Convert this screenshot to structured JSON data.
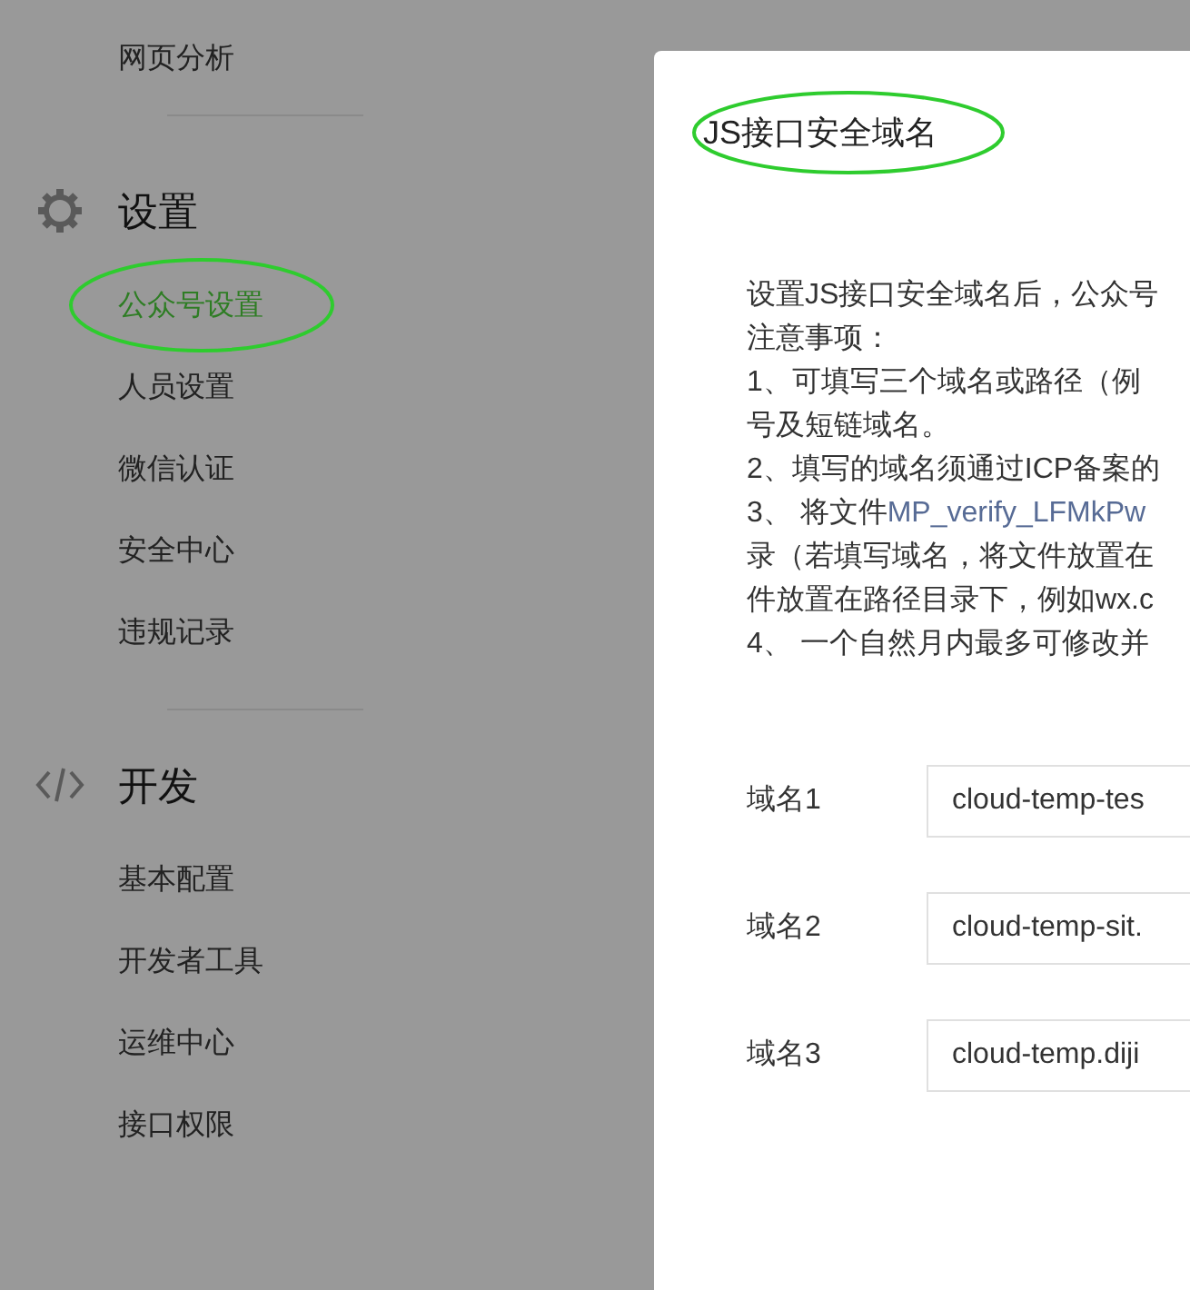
{
  "sidebar": {
    "top_item": {
      "label": "网页分析",
      "selected": false
    },
    "sections": [
      {
        "kind": "settings",
        "title": "设置",
        "items": [
          {
            "label": "公众号设置",
            "selected": true
          },
          {
            "label": "人员设置",
            "selected": false
          },
          {
            "label": "微信认证",
            "selected": false
          },
          {
            "label": "安全中心",
            "selected": false
          },
          {
            "label": "违规记录",
            "selected": false
          }
        ]
      },
      {
        "kind": "develop",
        "title": "开发",
        "items": [
          {
            "label": "基本配置",
            "selected": false
          },
          {
            "label": "开发者工具",
            "selected": false
          },
          {
            "label": "运维中心",
            "selected": false
          },
          {
            "label": "接口权限",
            "selected": false
          }
        ]
      }
    ]
  },
  "dialog": {
    "title": "JS接口安全域名",
    "notes": [
      {
        "text": "设置JS接口安全域名后，公众号"
      },
      {
        "text": "注意事项："
      },
      {
        "text": "1、可填写三个域名或路径（例"
      },
      {
        "text": "号及短链域名。"
      },
      {
        "text": "2、填写的域名须通过ICP备案的"
      },
      {
        "text": "3、 将文件",
        "link": "MP_verify_LFMkPw"
      },
      {
        "text": "录（若填写域名，将文件放置在"
      },
      {
        "text": "件放置在路径目录下，例如wx.c"
      },
      {
        "text": "4、 一个自然月内最多可修改并"
      }
    ],
    "fields": [
      {
        "label": "域名1",
        "value": "cloud-temp-tes"
      },
      {
        "label": "域名2",
        "value": "cloud-temp-sit."
      },
      {
        "label": "域名3",
        "value": "cloud-temp.diji"
      }
    ]
  }
}
